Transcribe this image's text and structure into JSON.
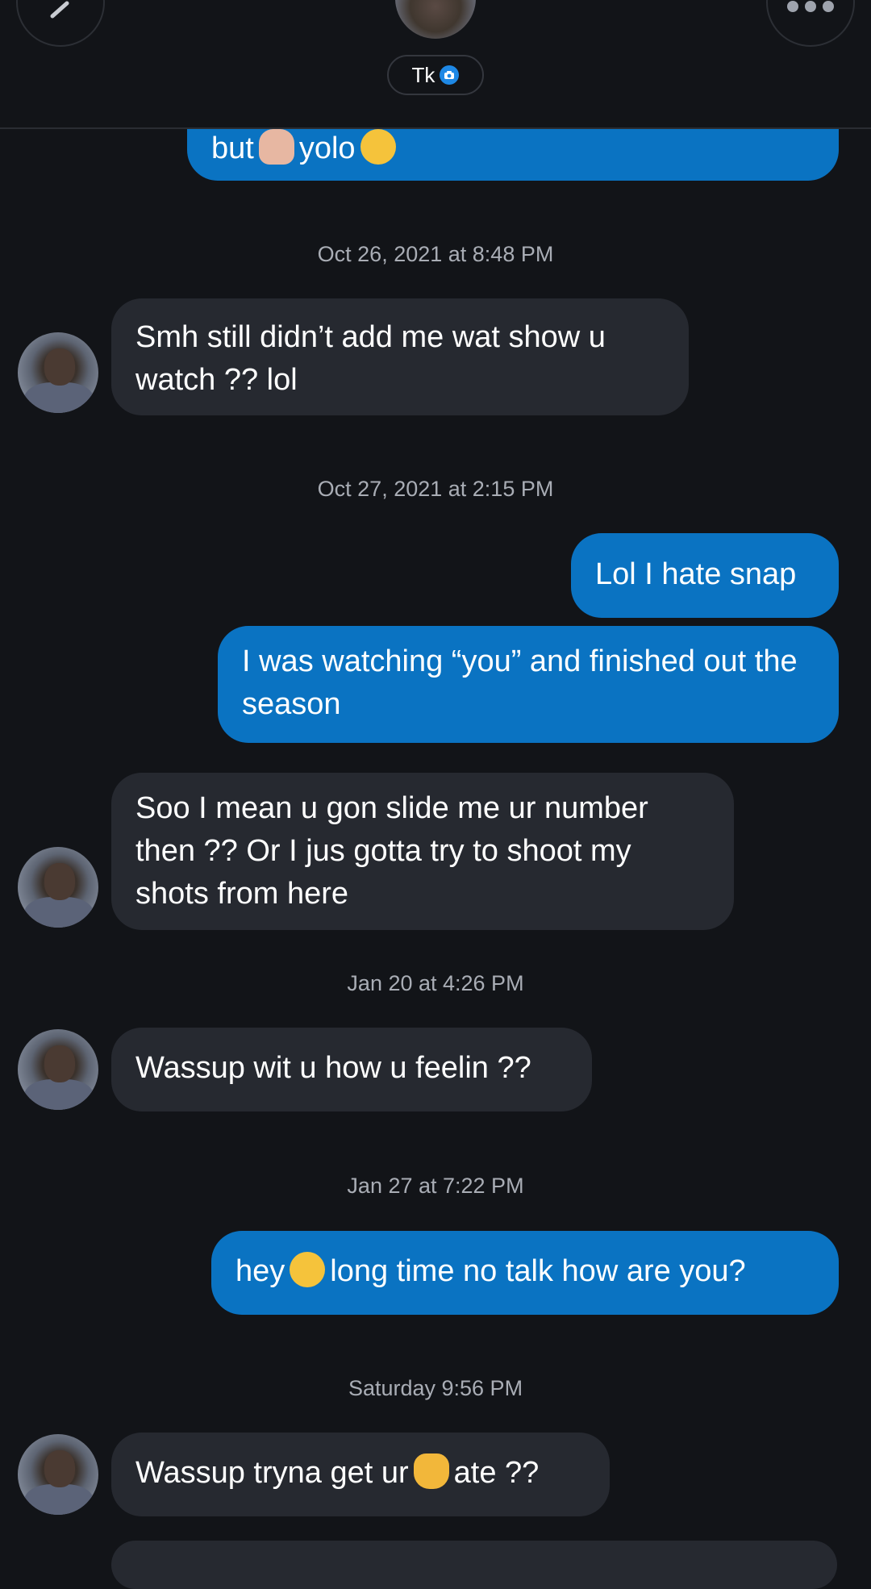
{
  "header": {
    "contact_name": "Tk",
    "back_icon": "chevron-left-icon",
    "more_icon": "more-dots-icon",
    "verified_icon": "camera-badge-icon"
  },
  "messages": [
    {
      "type": "outgoing",
      "text_before": "but",
      "emoji1": "shrug-emoji",
      "text_middle": "yolo",
      "emoji2": "laugh-cry-emoji"
    },
    {
      "type": "timestamp",
      "text": "Oct 26, 2021 at 8:48 PM"
    },
    {
      "type": "incoming",
      "text": "Smh still didn’t add me wat show u watch ?? lol"
    },
    {
      "type": "timestamp",
      "text": "Oct 27, 2021 at 2:15 PM"
    },
    {
      "type": "outgoing",
      "text": "Lol I hate snap"
    },
    {
      "type": "outgoing",
      "text": "I was watching “you” and finished out the season"
    },
    {
      "type": "incoming",
      "text": "Soo I mean u gon slide me ur number then ?? Or I jus gotta try to shoot my shots from here"
    },
    {
      "type": "timestamp",
      "text": "Jan 20 at 4:26 PM"
    },
    {
      "type": "incoming",
      "text": "Wassup wit u how u feelin ??"
    },
    {
      "type": "timestamp",
      "text": "Jan 27 at 7:22 PM"
    },
    {
      "type": "outgoing",
      "text_before": "hey",
      "emoji": "smiling-emoji",
      "text_after": "long time no talk how are you?"
    },
    {
      "type": "timestamp",
      "text": "Saturday 9:56 PM"
    },
    {
      "type": "incoming",
      "text_before": "Wassup tryna get ur",
      "emoji": "cat-emoji",
      "text_after": "ate ??"
    }
  ],
  "colors": {
    "background": "#121418",
    "outgoing_bubble": "#0a73c2",
    "incoming_bubble": "#262930",
    "timestamp_text": "#a9adb5"
  }
}
